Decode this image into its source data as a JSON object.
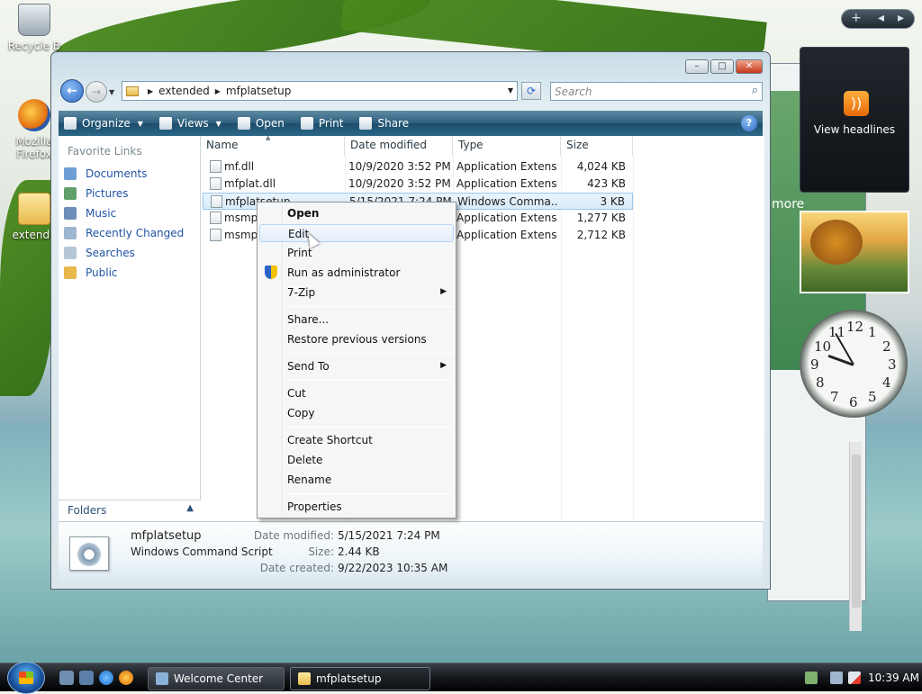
{
  "desktop": {
    "icons": [
      {
        "label": "Recycle Bin",
        "shown": "Recycle B"
      },
      {
        "label": "Mozilla Firefox",
        "shown_line1": "Mozilla",
        "shown_line2": "Firefox"
      },
      {
        "label": "extended",
        "shown": "extende"
      }
    ]
  },
  "gadgets": {
    "toolbar_plus": "+",
    "toolbar_prev": "◂",
    "toolbar_next": "▸",
    "rss_label": "View headlines",
    "clock_numbers": [
      "12",
      "1",
      "2",
      "3",
      "4",
      "5",
      "6",
      "7",
      "8",
      "9",
      "10",
      "11"
    ]
  },
  "bg_window": {
    "partial_text": "more"
  },
  "window": {
    "controls": {
      "minimize": "–",
      "maximize": "□",
      "close": "✕"
    },
    "address": {
      "crumbs": [
        "extended",
        "mfplatsetup"
      ]
    },
    "search": {
      "placeholder": "Search"
    },
    "toolbar": {
      "organize": "Organize",
      "views": "Views",
      "open": "Open",
      "print": "Print",
      "share": "Share",
      "help": "?"
    },
    "left_pane": {
      "title": "Favorite Links",
      "links": [
        "Documents",
        "Pictures",
        "Music",
        "Recently Changed",
        "Searches",
        "Public"
      ],
      "folders_label": "Folders"
    },
    "columns": [
      "Name",
      "Date modified",
      "Type",
      "Size"
    ],
    "files": [
      {
        "name": "mf.dll",
        "date": "10/9/2020 3:52 PM",
        "type": "Application Extens...",
        "size": "4,024 KB"
      },
      {
        "name": "mfplat.dll",
        "date": "10/9/2020 3:52 PM",
        "type": "Application Extens...",
        "size": "423 KB"
      },
      {
        "name": "mfplatsetup",
        "date": "5/15/2021 7:24 PM",
        "type": "Windows Comma...",
        "size": "3 KB"
      },
      {
        "name": "msmp",
        "date": "",
        "type": "Application Extens...",
        "size": "1,277 KB"
      },
      {
        "name": "msmp",
        "date": "",
        "type": "Application Extens...",
        "size": "2,712 KB"
      }
    ],
    "details": {
      "name": "mfplatsetup",
      "type": "Windows Command Script",
      "date_modified_label": "Date modified:",
      "date_modified": "5/15/2021 7:24 PM",
      "size_label": "Size:",
      "size": "2.44 KB",
      "date_created_label": "Date created:",
      "date_created": "9/22/2023 10:35 AM"
    }
  },
  "context_menu": {
    "items": [
      "Open",
      "Edit",
      "Print",
      "Run as administrator",
      "7-Zip",
      "Share...",
      "Restore previous versions",
      "Send To",
      "Cut",
      "Copy",
      "Create Shortcut",
      "Delete",
      "Rename",
      "Properties"
    ],
    "submenu_arrow": "▶"
  },
  "taskbar": {
    "tasks": [
      "Welcome Center",
      "mfplatsetup"
    ],
    "time": "10:39 AM"
  },
  "colors": {
    "link_blue": "#2154a6",
    "toolbar_dark": "#1d4d6b",
    "selection": "#d8ebfa"
  }
}
